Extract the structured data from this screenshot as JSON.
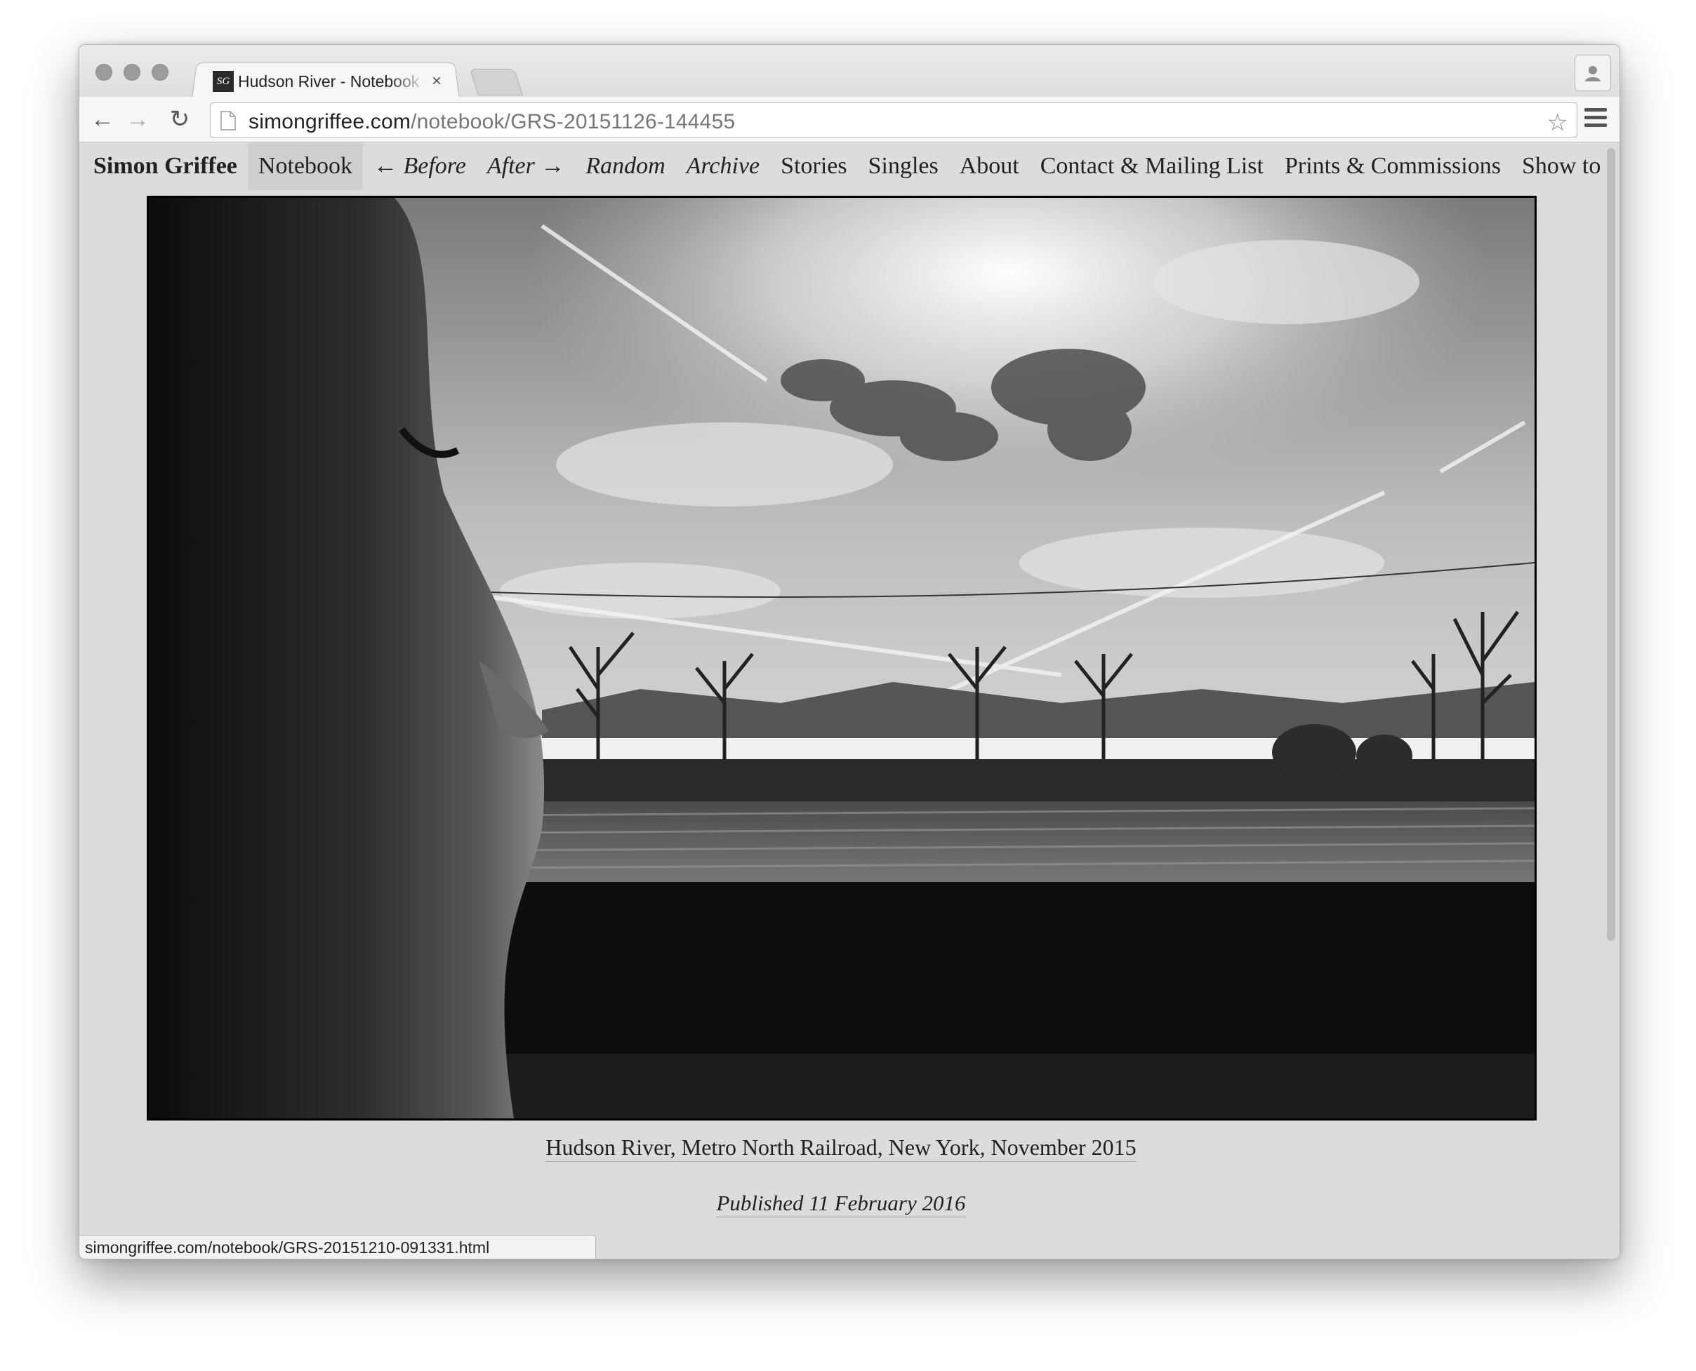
{
  "browser": {
    "tab_title": "Hudson River - Notebook - Simon Griffee",
    "favicon_text": "SG",
    "close_glyph": "×",
    "url_host": "simongriffee.com",
    "url_path": "/notebook/GRS-20151126-144455",
    "status_url": "simongriffee.com/notebook/GRS-20151210-091331.html",
    "back_glyph": "←",
    "forward_glyph": "→",
    "reload_glyph": "↻",
    "star_glyph": "☆"
  },
  "site": {
    "brand": "Simon Griffee",
    "nav": [
      {
        "label": "Notebook"
      },
      {
        "label": "← Before"
      },
      {
        "label": "After →"
      },
      {
        "label": "Random"
      },
      {
        "label": "Archive"
      },
      {
        "label": "Stories"
      },
      {
        "label": "Singles"
      },
      {
        "label": "About"
      },
      {
        "label": "Contact & Mailing List"
      },
      {
        "label": "Prints & Commissions"
      },
      {
        "label": "Show to a friend"
      }
    ]
  },
  "post": {
    "caption": "Hudson River, Metro North Railroad, New York, November 2015",
    "published": "Published 11 February 2016"
  }
}
